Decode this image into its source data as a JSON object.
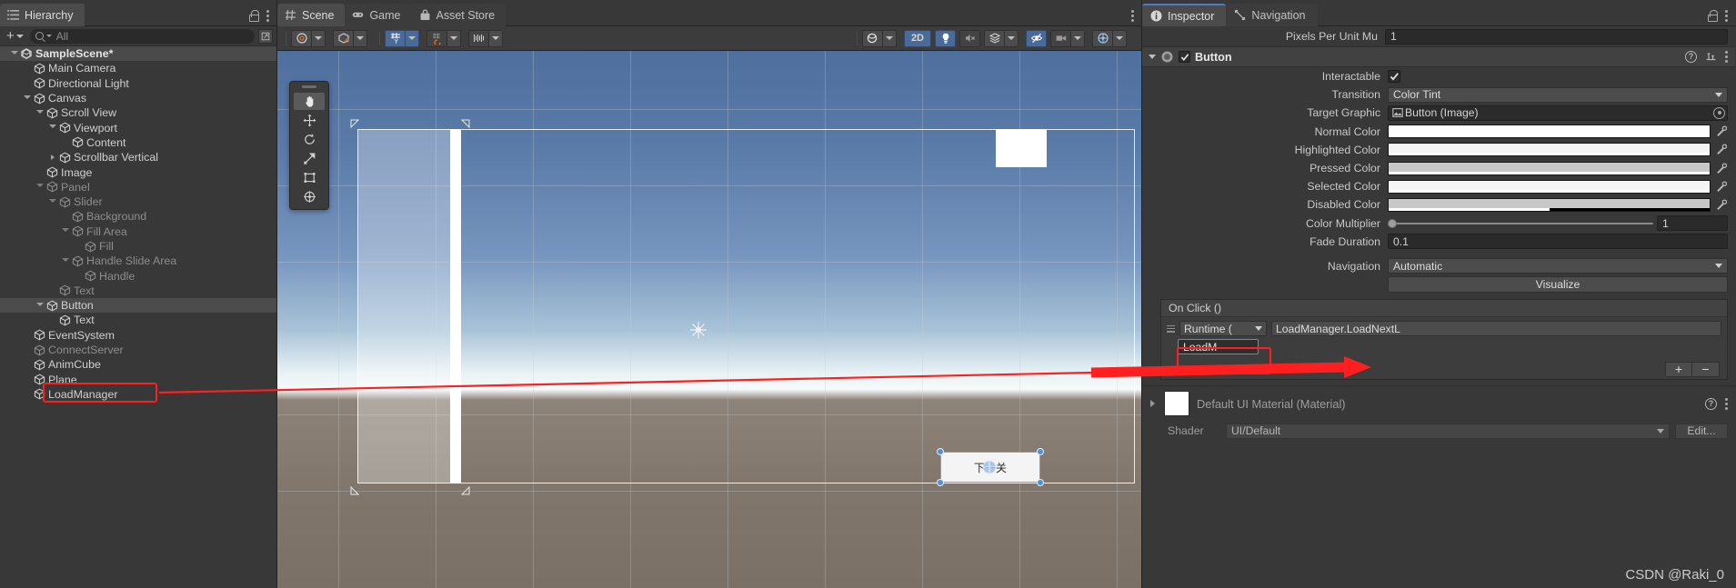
{
  "hierarchy": {
    "tab_label": "Hierarchy",
    "tab_icon": "hierarchy-icon",
    "add_label": "+",
    "search_placeholder": "All",
    "search_value": "",
    "items": [
      {
        "label": "SampleScene*",
        "depth": 0,
        "fold": "open",
        "kind": "scene",
        "dim": false,
        "selected": false
      },
      {
        "label": "Main Camera",
        "depth": 1,
        "fold": "none",
        "kind": "go",
        "dim": false,
        "selected": false
      },
      {
        "label": "Directional Light",
        "depth": 1,
        "fold": "none",
        "kind": "go",
        "dim": false,
        "selected": false
      },
      {
        "label": "Canvas",
        "depth": 1,
        "fold": "open",
        "kind": "go",
        "dim": false,
        "selected": false
      },
      {
        "label": "Scroll View",
        "depth": 2,
        "fold": "open",
        "kind": "go",
        "dim": false,
        "selected": false
      },
      {
        "label": "Viewport",
        "depth": 3,
        "fold": "open",
        "kind": "go",
        "dim": false,
        "selected": false
      },
      {
        "label": "Content",
        "depth": 4,
        "fold": "none",
        "kind": "go",
        "dim": false,
        "selected": false
      },
      {
        "label": "Scrollbar Vertical",
        "depth": 3,
        "fold": "closed",
        "kind": "go",
        "dim": false,
        "selected": false
      },
      {
        "label": "Image",
        "depth": 2,
        "fold": "none",
        "kind": "go",
        "dim": false,
        "selected": false
      },
      {
        "label": "Panel",
        "depth": 2,
        "fold": "open",
        "kind": "go",
        "dim": true,
        "selected": false
      },
      {
        "label": "Slider",
        "depth": 3,
        "fold": "open",
        "kind": "go",
        "dim": true,
        "selected": false
      },
      {
        "label": "Background",
        "depth": 4,
        "fold": "none",
        "kind": "go",
        "dim": true,
        "selected": false
      },
      {
        "label": "Fill Area",
        "depth": 4,
        "fold": "open",
        "kind": "go",
        "dim": true,
        "selected": false
      },
      {
        "label": "Fill",
        "depth": 5,
        "fold": "none",
        "kind": "go",
        "dim": true,
        "selected": false
      },
      {
        "label": "Handle Slide Area",
        "depth": 4,
        "fold": "open",
        "kind": "go",
        "dim": true,
        "selected": false
      },
      {
        "label": "Handle",
        "depth": 5,
        "fold": "none",
        "kind": "go",
        "dim": true,
        "selected": false
      },
      {
        "label": "Text",
        "depth": 3,
        "fold": "none",
        "kind": "go",
        "dim": true,
        "selected": false
      },
      {
        "label": "Button",
        "depth": 2,
        "fold": "open",
        "kind": "go",
        "dim": false,
        "selected": true
      },
      {
        "label": "Text",
        "depth": 3,
        "fold": "none",
        "kind": "go",
        "dim": false,
        "selected": false
      },
      {
        "label": "EventSystem",
        "depth": 1,
        "fold": "none",
        "kind": "go",
        "dim": false,
        "selected": false
      },
      {
        "label": "ConnectServer",
        "depth": 1,
        "fold": "none",
        "kind": "go",
        "dim": true,
        "selected": false
      },
      {
        "label": "AnimCube",
        "depth": 1,
        "fold": "none",
        "kind": "go",
        "dim": false,
        "selected": false
      },
      {
        "label": "Plane",
        "depth": 1,
        "fold": "none",
        "kind": "go",
        "dim": false,
        "selected": false
      },
      {
        "label": "LoadManager",
        "depth": 1,
        "fold": "none",
        "kind": "go",
        "dim": false,
        "selected": false
      }
    ],
    "highlight_item": "LoadManager"
  },
  "center": {
    "tabs": [
      {
        "label": "Scene",
        "icon": "grid-icon",
        "active": true
      },
      {
        "label": "Game",
        "icon": "gamepad-icon",
        "active": false
      },
      {
        "label": "Asset Store",
        "icon": "store-icon",
        "active": false
      }
    ],
    "toolbar_left": [
      {
        "name": "draw-mode-dropdown",
        "icon": "shaded-icon",
        "caret": true,
        "active": false
      },
      {
        "name": "render-mode-dropdown",
        "icon": "cube-icon",
        "caret": true,
        "active": false
      },
      {
        "name": "grid-snap-toggle",
        "icon": "grid-y-icon",
        "caret": true,
        "active": true
      },
      {
        "name": "snap-increment",
        "icon": "snap-icon",
        "caret": true,
        "active": false
      },
      {
        "name": "grid-size",
        "icon": "ruler-icon",
        "caret": true,
        "active": false
      }
    ],
    "toolbar_right": [
      {
        "name": "lighting-dropdown",
        "icon": "sphere-icon",
        "caret": true,
        "active": false
      },
      {
        "name": "2d-toggle",
        "label": "2D",
        "active": true
      },
      {
        "name": "scene-lighting-toggle",
        "icon": "bulb-icon",
        "active": true
      },
      {
        "name": "audio-toggle",
        "icon": "mute-audio-icon",
        "active": false
      },
      {
        "name": "fx-dropdown",
        "icon": "fx-icon",
        "caret": true,
        "active": false
      },
      {
        "name": "hidden-objects-toggle",
        "icon": "eye-off-icon",
        "active": true
      },
      {
        "name": "camera-dropdown",
        "icon": "camera-icon",
        "caret": true,
        "active": false
      },
      {
        "name": "gizmos-dropdown",
        "icon": "gizmo-icon",
        "caret": true,
        "active": false
      }
    ],
    "tool_palette": [
      {
        "name": "hand-tool",
        "icon": "hand-icon",
        "active": true
      },
      {
        "name": "move-tool",
        "icon": "move-icon",
        "active": false
      },
      {
        "name": "rotate-tool",
        "icon": "rotate-icon",
        "active": false
      },
      {
        "name": "scale-tool",
        "icon": "scale-icon",
        "active": false
      },
      {
        "name": "rect-tool",
        "icon": "rect-icon",
        "active": false
      },
      {
        "name": "transform-tool",
        "icon": "transform-icon",
        "active": false
      }
    ],
    "scene_button_label": "下一关"
  },
  "inspector": {
    "tabs": [
      {
        "label": "Inspector",
        "icon": "info-icon",
        "active": true
      },
      {
        "label": "Navigation",
        "icon": "navigation-icon",
        "active": false
      }
    ],
    "pixels_per_unit": {
      "label": "Pixels Per Unit Mu",
      "value": "1"
    },
    "component": {
      "title": "Button",
      "enabled": true,
      "icon": "button-component-icon"
    },
    "properties": [
      {
        "name": "interactable",
        "label": "Interactable",
        "type": "checkbox",
        "value": true,
        "indent": 0
      },
      {
        "name": "transition",
        "label": "Transition",
        "type": "dropdown",
        "value": "Color Tint",
        "indent": 0
      },
      {
        "name": "target-graphic",
        "label": "Target Graphic",
        "type": "object",
        "value": "Button (Image)",
        "indent": 1
      },
      {
        "name": "normal-color",
        "label": "Normal Color",
        "type": "color",
        "value": "#FFFFFF",
        "alpha": 1.0,
        "indent": 1
      },
      {
        "name": "highlighted-color",
        "label": "Highlighted Color",
        "type": "color",
        "value": "#F5F5F5",
        "alpha": 1.0,
        "indent": 1
      },
      {
        "name": "pressed-color",
        "label": "Pressed Color",
        "type": "color",
        "value": "#C8C8C8",
        "alpha": 1.0,
        "indent": 1
      },
      {
        "name": "selected-color",
        "label": "Selected Color",
        "type": "color",
        "value": "#F5F5F5",
        "alpha": 1.0,
        "indent": 1
      },
      {
        "name": "disabled-color",
        "label": "Disabled Color",
        "type": "color",
        "value": "#C8C8C8",
        "alpha": 0.5,
        "indent": 1
      },
      {
        "name": "color-multiplier",
        "label": "Color Multiplier",
        "type": "slider",
        "value": "1",
        "percent": 0,
        "indent": 1
      },
      {
        "name": "fade-duration",
        "label": "Fade Duration",
        "type": "number",
        "value": "0.1",
        "indent": 1
      }
    ],
    "navigation": {
      "label": "Navigation",
      "value": "Automatic",
      "button_label": "Visualize"
    },
    "on_click": {
      "header": "On Click ()",
      "timing": "Runtime (",
      "function": "LoadManager.LoadNextL",
      "object": "LoadM",
      "add_label": "+",
      "remove_label": "−"
    },
    "material": {
      "title": "Default UI Material (Material)",
      "shader_label": "Shader",
      "shader_value": "UI/Default",
      "edit_label": "Edit..."
    },
    "watermark": "CSDN @Raki_0"
  },
  "colors": {
    "accent_blue": "#4a6a97",
    "annotation_red": "#ff1f1f",
    "panel_bg": "#383838",
    "selection": "#4b4b4b"
  }
}
